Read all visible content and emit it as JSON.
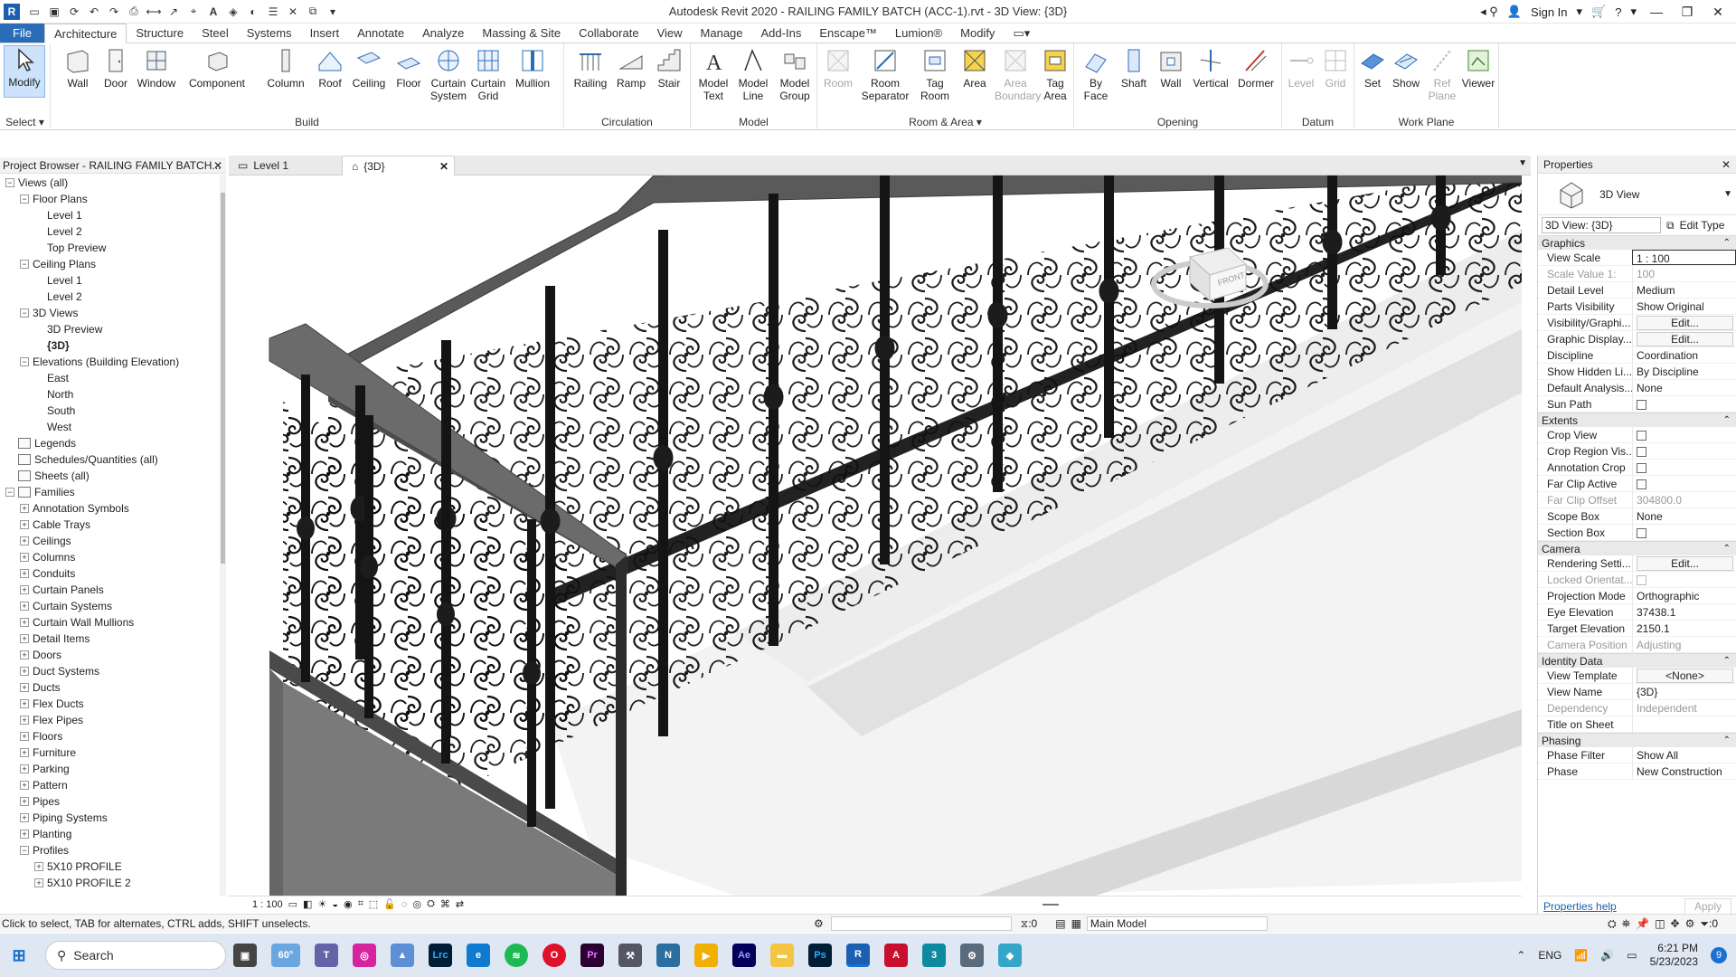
{
  "app": {
    "title": "Autodesk Revit 2020 - RAILING FAMILY BATCH (ACC-1).rvt - 3D View: {3D}",
    "sign_in": "Sign In"
  },
  "tabs": [
    "File",
    "Architecture",
    "Structure",
    "Steel",
    "Systems",
    "Insert",
    "Annotate",
    "Analyze",
    "Massing & Site",
    "Collaborate",
    "View",
    "Manage",
    "Add-Ins",
    "Enscape™",
    "Lumion®",
    "Modify"
  ],
  "ribbon": {
    "select": {
      "modify": "Modify",
      "title": "Select ▾"
    },
    "build": {
      "title": "Build",
      "buttons": [
        "Wall",
        "Door",
        "Window",
        "Component",
        "Column",
        "Roof",
        "Ceiling",
        "Floor",
        "Curtain System",
        "Curtain Grid",
        "Mullion"
      ]
    },
    "circulation": {
      "title": "Circulation",
      "buttons": [
        "Railing",
        "Ramp",
        "Stair"
      ]
    },
    "model": {
      "title": "Model",
      "buttons": [
        "Model Text",
        "Model Line",
        "Model Group"
      ]
    },
    "room_area": {
      "title": "Room & Area ▾",
      "buttons": [
        "Room",
        "Room Separator",
        "Tag Room",
        "Area",
        "Area Boundary",
        "Tag Area"
      ]
    },
    "opening": {
      "title": "Opening",
      "buttons": [
        "By Face",
        "Shaft",
        "Wall",
        "Vertical",
        "Dormer"
      ]
    },
    "datum": {
      "title": "Datum",
      "buttons": [
        "Level",
        "Grid"
      ]
    },
    "work_plane": {
      "title": "Work Plane",
      "buttons": [
        "Set",
        "Show",
        "Ref Plane",
        "Viewer"
      ]
    }
  },
  "project_browser": {
    "title": "Project Browser - RAILING FAMILY BATCH...",
    "tree": [
      {
        "label": "Views (all)",
        "level": 0,
        "tog": "−"
      },
      {
        "label": "Floor Plans",
        "level": 1,
        "tog": "−"
      },
      {
        "label": "Level 1",
        "level": 2,
        "tog": ""
      },
      {
        "label": "Level 2",
        "level": 2,
        "tog": ""
      },
      {
        "label": "Top Preview",
        "level": 2,
        "tog": ""
      },
      {
        "label": "Ceiling Plans",
        "level": 1,
        "tog": "−"
      },
      {
        "label": "Level 1",
        "level": 2,
        "tog": ""
      },
      {
        "label": "Level 2",
        "level": 2,
        "tog": ""
      },
      {
        "label": "3D Views",
        "level": 1,
        "tog": "−"
      },
      {
        "label": "3D Preview",
        "level": 2,
        "tog": ""
      },
      {
        "label": "{3D}",
        "level": 2,
        "tog": "",
        "bold": true
      },
      {
        "label": "Elevations (Building Elevation)",
        "level": 1,
        "tog": "−"
      },
      {
        "label": "East",
        "level": 2,
        "tog": ""
      },
      {
        "label": "North",
        "level": 2,
        "tog": ""
      },
      {
        "label": "South",
        "level": 2,
        "tog": ""
      },
      {
        "label": "West",
        "level": 2,
        "tog": ""
      },
      {
        "label": "Legends",
        "level": 0,
        "tog": "",
        "icon": true
      },
      {
        "label": "Schedules/Quantities (all)",
        "level": 0,
        "tog": "",
        "icon": true
      },
      {
        "label": "Sheets (all)",
        "level": 0,
        "tog": "",
        "icon": true
      },
      {
        "label": "Families",
        "level": 0,
        "tog": "−",
        "icon": true
      },
      {
        "label": "Annotation Symbols",
        "level": 1,
        "tog": "+"
      },
      {
        "label": "Cable Trays",
        "level": 1,
        "tog": "+"
      },
      {
        "label": "Ceilings",
        "level": 1,
        "tog": "+"
      },
      {
        "label": "Columns",
        "level": 1,
        "tog": "+"
      },
      {
        "label": "Conduits",
        "level": 1,
        "tog": "+"
      },
      {
        "label": "Curtain Panels",
        "level": 1,
        "tog": "+"
      },
      {
        "label": "Curtain Systems",
        "level": 1,
        "tog": "+"
      },
      {
        "label": "Curtain Wall Mullions",
        "level": 1,
        "tog": "+"
      },
      {
        "label": "Detail Items",
        "level": 1,
        "tog": "+"
      },
      {
        "label": "Doors",
        "level": 1,
        "tog": "+"
      },
      {
        "label": "Duct Systems",
        "level": 1,
        "tog": "+"
      },
      {
        "label": "Ducts",
        "level": 1,
        "tog": "+"
      },
      {
        "label": "Flex Ducts",
        "level": 1,
        "tog": "+"
      },
      {
        "label": "Flex Pipes",
        "level": 1,
        "tog": "+"
      },
      {
        "label": "Floors",
        "level": 1,
        "tog": "+"
      },
      {
        "label": "Furniture",
        "level": 1,
        "tog": "+"
      },
      {
        "label": "Parking",
        "level": 1,
        "tog": "+"
      },
      {
        "label": "Pattern",
        "level": 1,
        "tog": "+"
      },
      {
        "label": "Pipes",
        "level": 1,
        "tog": "+"
      },
      {
        "label": "Piping Systems",
        "level": 1,
        "tog": "+"
      },
      {
        "label": "Planting",
        "level": 1,
        "tog": "+"
      },
      {
        "label": "Profiles",
        "level": 1,
        "tog": "−"
      },
      {
        "label": "5X10 PROFILE",
        "level": 2,
        "tog": "+"
      },
      {
        "label": "5X10 PROFILE 2",
        "level": 2,
        "tog": "+"
      }
    ]
  },
  "doc_tabs": [
    {
      "label": "Level 1"
    },
    {
      "label": "{3D}"
    }
  ],
  "view_control": {
    "scale": "1 : 100"
  },
  "properties": {
    "title": "Properties",
    "type_name": "3D View",
    "selector": "3D View: {3D}",
    "edit_type": "Edit Type",
    "groups": [
      {
        "name": "Graphics",
        "rows": [
          {
            "k": "View Scale",
            "v": "1 : 100"
          },
          {
            "k": "Scale Value 1:",
            "v": "100",
            "dim": true
          },
          {
            "k": "Detail Level",
            "v": "Medium"
          },
          {
            "k": "Parts Visibility",
            "v": "Show Original"
          },
          {
            "k": "Visibility/Graphi...",
            "v": "Edit...",
            "btn": true
          },
          {
            "k": "Graphic Display...",
            "v": "Edit...",
            "btn": true
          },
          {
            "k": "Discipline",
            "v": "Coordination"
          },
          {
            "k": "Show Hidden Li...",
            "v": "By Discipline"
          },
          {
            "k": "Default Analysis...",
            "v": "None"
          },
          {
            "k": "Sun Path",
            "v": "",
            "cb": true
          }
        ]
      },
      {
        "name": "Extents",
        "rows": [
          {
            "k": "Crop View",
            "v": "",
            "cb": true
          },
          {
            "k": "Crop Region Vis...",
            "v": "",
            "cb": true
          },
          {
            "k": "Annotation Crop",
            "v": "",
            "cb": true
          },
          {
            "k": "Far Clip Active",
            "v": "",
            "cb": true
          },
          {
            "k": "Far Clip Offset",
            "v": "304800.0",
            "dim": true
          },
          {
            "k": "Scope Box",
            "v": "None"
          },
          {
            "k": "Section Box",
            "v": "",
            "cb": true
          }
        ]
      },
      {
        "name": "Camera",
        "rows": [
          {
            "k": "Rendering Setti...",
            "v": "Edit...",
            "btn": true
          },
          {
            "k": "Locked Orientat...",
            "v": "",
            "cb": true,
            "dim": true
          },
          {
            "k": "Projection Mode",
            "v": "Orthographic"
          },
          {
            "k": "Eye Elevation",
            "v": "37438.1"
          },
          {
            "k": "Target Elevation",
            "v": "2150.1"
          },
          {
            "k": "Camera Position",
            "v": "Adjusting",
            "dim": true
          }
        ]
      },
      {
        "name": "Identity Data",
        "rows": [
          {
            "k": "View Template",
            "v": "<None>",
            "btn": true
          },
          {
            "k": "View Name",
            "v": "{3D}"
          },
          {
            "k": "Dependency",
            "v": "Independent",
            "dim": true
          },
          {
            "k": "Title on Sheet",
            "v": ""
          }
        ]
      },
      {
        "name": "Phasing",
        "rows": [
          {
            "k": "Phase Filter",
            "v": "Show All"
          },
          {
            "k": "Phase",
            "v": "New Construction"
          }
        ]
      }
    ],
    "help": "Properties help",
    "apply": "Apply"
  },
  "status": {
    "hint": "Click to select, TAB for alternates, CTRL adds, SHIFT unselects.",
    "workset_count": ":0",
    "model": "Main Model",
    "filter_count": ":0"
  },
  "taskbar": {
    "search": "Search",
    "weather": "60°",
    "lang": "ENG",
    "time": "6:21 PM",
    "date": "5/23/2023",
    "badge": "9"
  },
  "colors": {
    "accent": "#2b6cb8",
    "railing": "#111111",
    "rail_top": "#5e5e5e"
  }
}
